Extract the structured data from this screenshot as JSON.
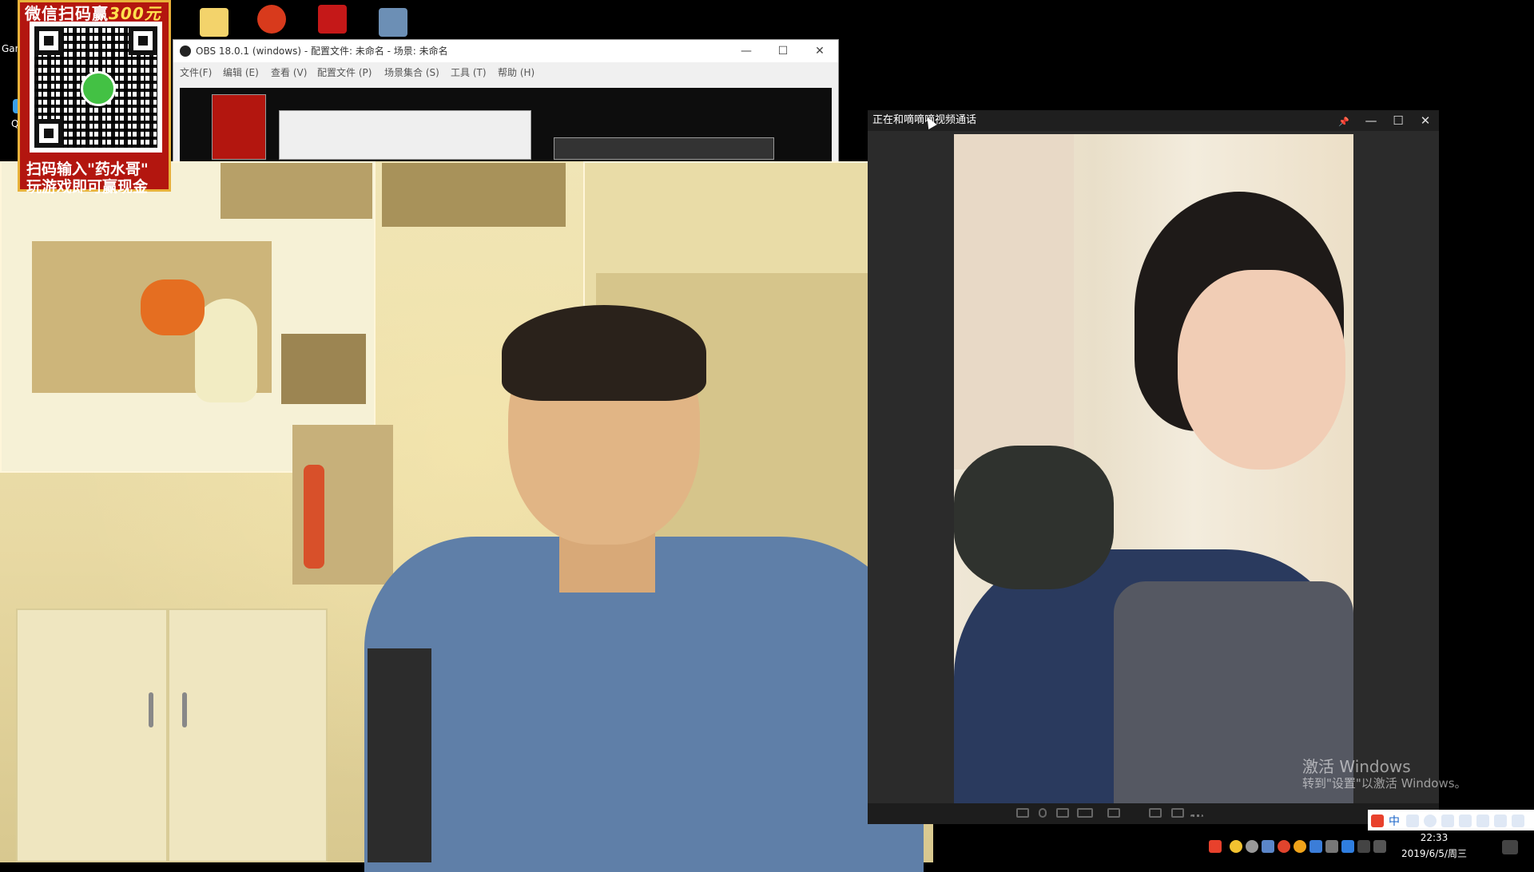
{
  "desktop": {
    "icons": [
      {
        "name": "folder-icon",
        "color": "#f3d36b"
      },
      {
        "name": "cf-game-icon",
        "color": "#d83a1c"
      },
      {
        "name": "game-app-icon",
        "color": "#c51818"
      },
      {
        "name": "app-icon",
        "color": "#6c8fb5"
      }
    ],
    "label_game": "Gam",
    "label_qq": "QQ"
  },
  "promo": {
    "title_prefix": "微信扫码赢",
    "title_amount": "300元",
    "line1": "扫码输入\"药水哥\"",
    "line2": "玩游戏即可赢现金"
  },
  "obs": {
    "title": "OBS 18.0.1 (windows) - 配置文件: 未命名 - 场景: 未命名",
    "minimize": "—",
    "maximize": "☐",
    "close": "✕",
    "menu": [
      "文件(F)",
      "编辑 (E)",
      "查看 (V)",
      "配置文件 (P)",
      "场景集合 (S)",
      "工具 (T)",
      "帮助 (H)"
    ]
  },
  "call": {
    "title": "正在和嘀嘀嘀视频通话",
    "pin": "📌",
    "minimize": "—",
    "maximize": "☐",
    "close": "✕"
  },
  "watermark": {
    "line1": "激活 Windows",
    "line2": "转到\"设置\"以激活 Windows。"
  },
  "tray": {
    "time": "22:33",
    "date": "2019/6/5/周三",
    "ime_label": "中"
  },
  "colors": {
    "accent_red": "#b3160f",
    "promo_gold": "#ffe14d",
    "call_bg": "#2b2b2b"
  }
}
